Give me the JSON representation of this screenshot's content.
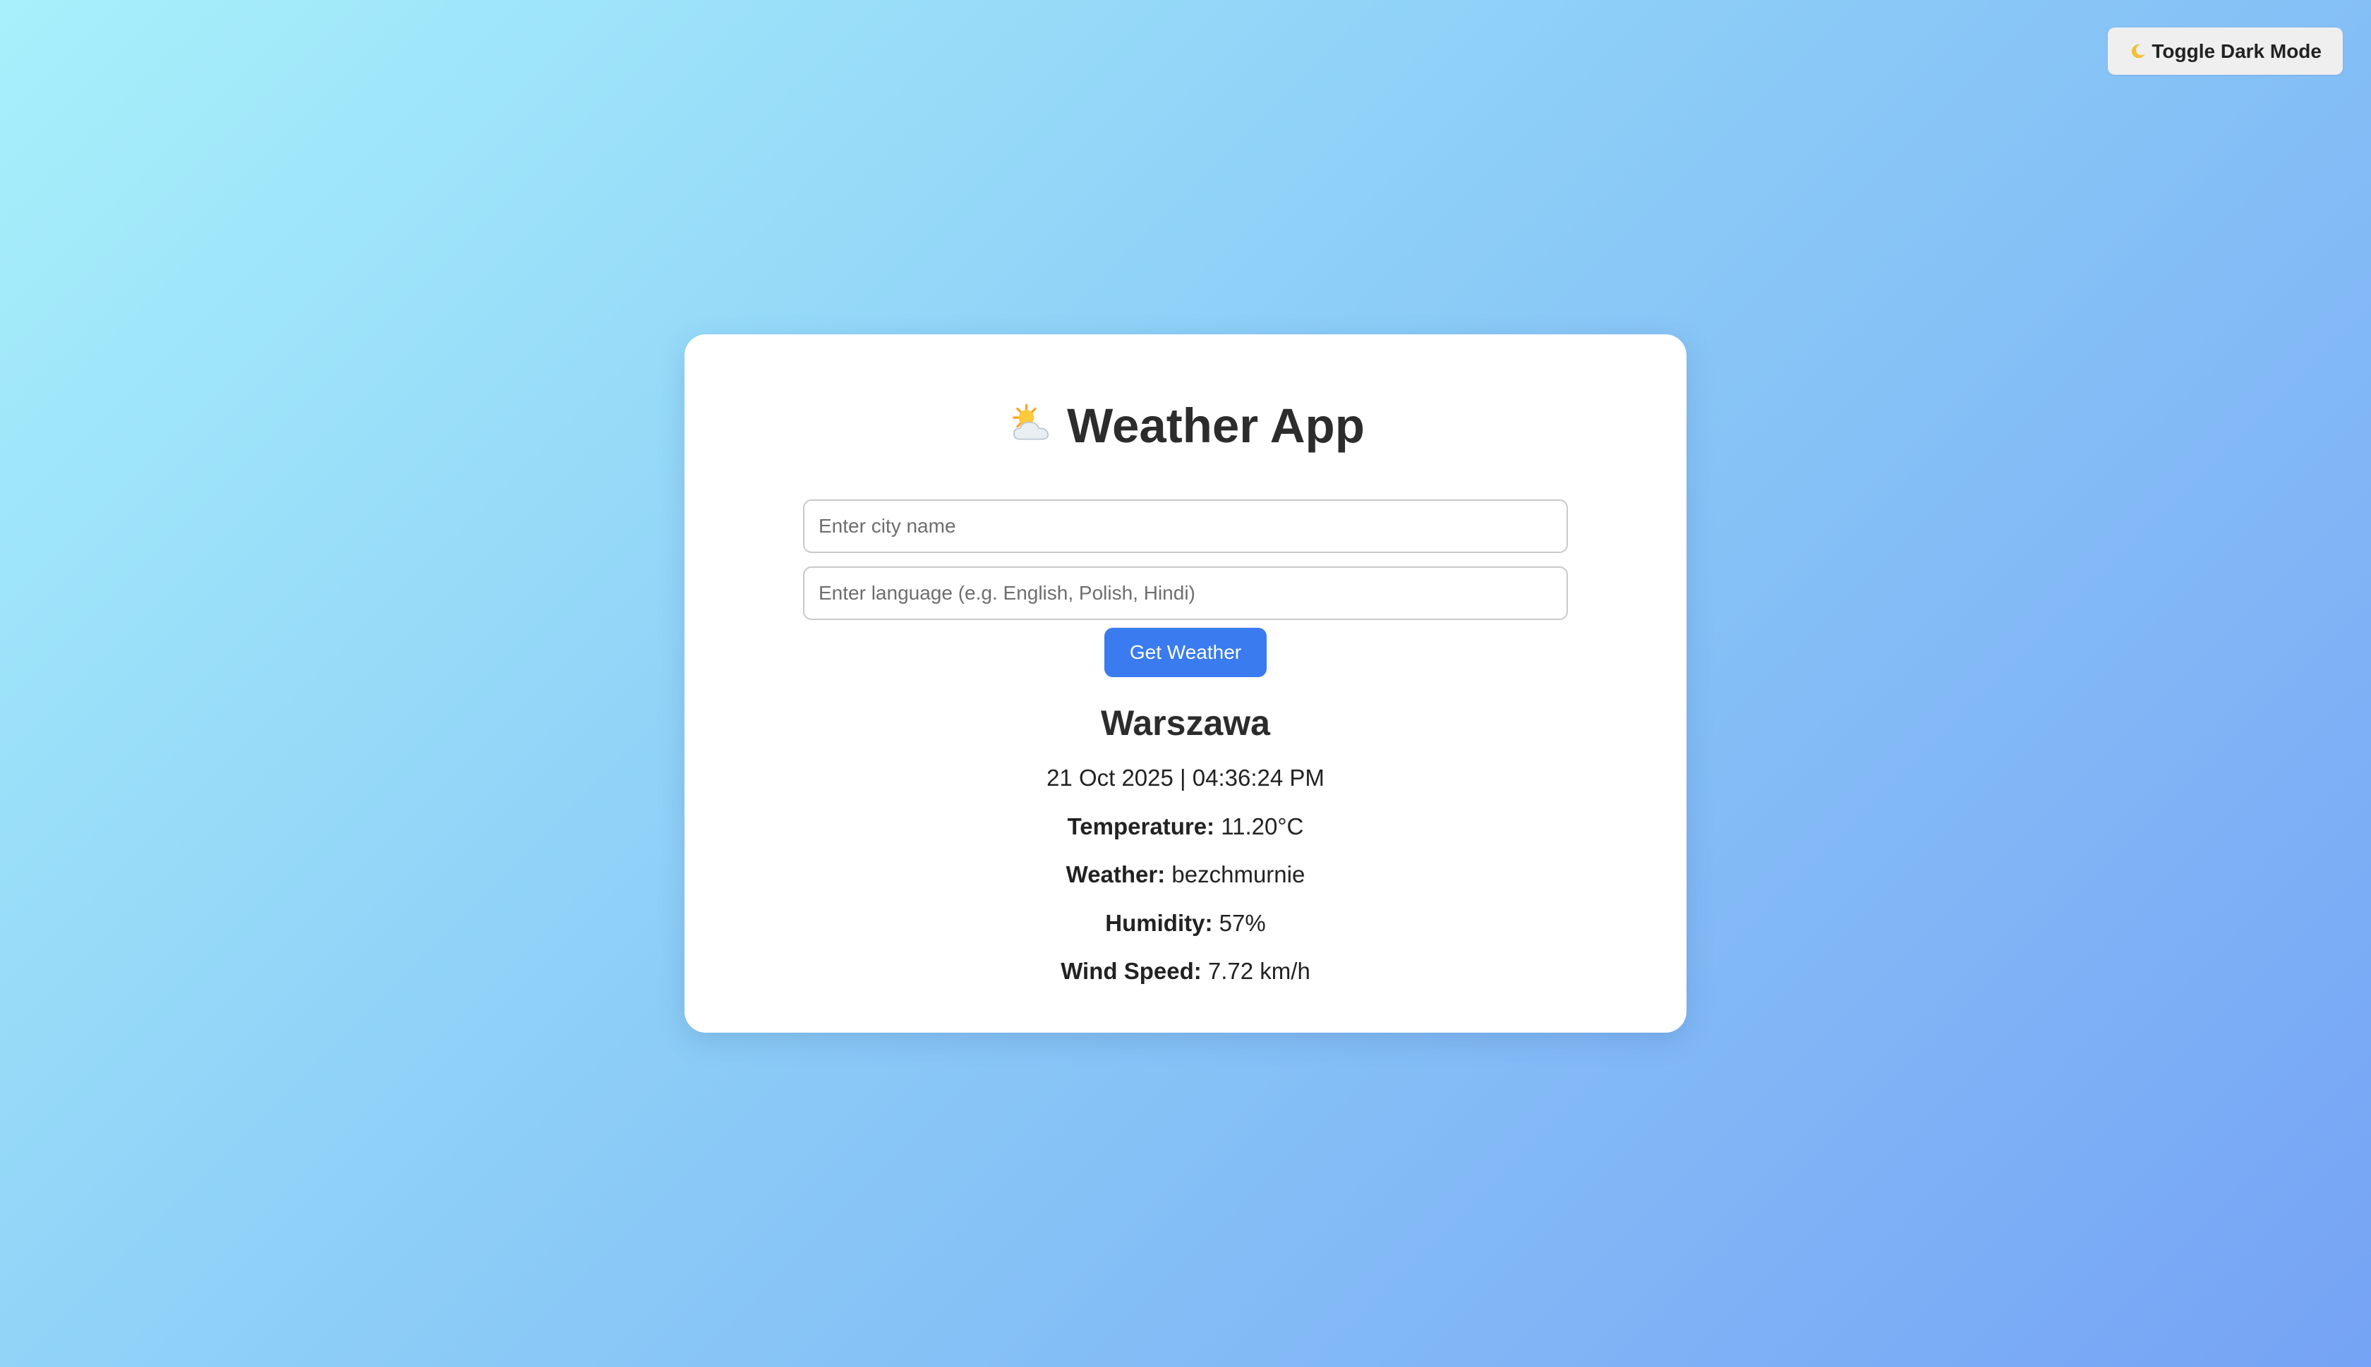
{
  "toolbar": {
    "dark_mode_label": "Toggle Dark Mode",
    "dark_mode_icon": "moon-icon"
  },
  "app": {
    "title": "Weather App",
    "title_icon": "sun-behind-cloud-icon"
  },
  "form": {
    "city_placeholder": "Enter city name",
    "city_value": "",
    "language_placeholder": "Enter language (e.g. English, Polish, Hindi)",
    "language_value": "",
    "submit_label": "Get Weather"
  },
  "result": {
    "city": "Warszawa",
    "datetime": "21 Oct 2025 | 04:36:24 PM",
    "temperature_label": "Temperature:",
    "temperature_value": "11.20°C",
    "weather_label": "Weather:",
    "weather_value": "bezchmurnie",
    "humidity_label": "Humidity:",
    "humidity_value": "57%",
    "wind_label": "Wind Speed:",
    "wind_value": "7.72 km/h"
  },
  "colors": {
    "accent": "#3a7bef",
    "card": "#ffffff",
    "gradient_start": "#a8f0fb",
    "gradient_end": "#76a3f5"
  }
}
